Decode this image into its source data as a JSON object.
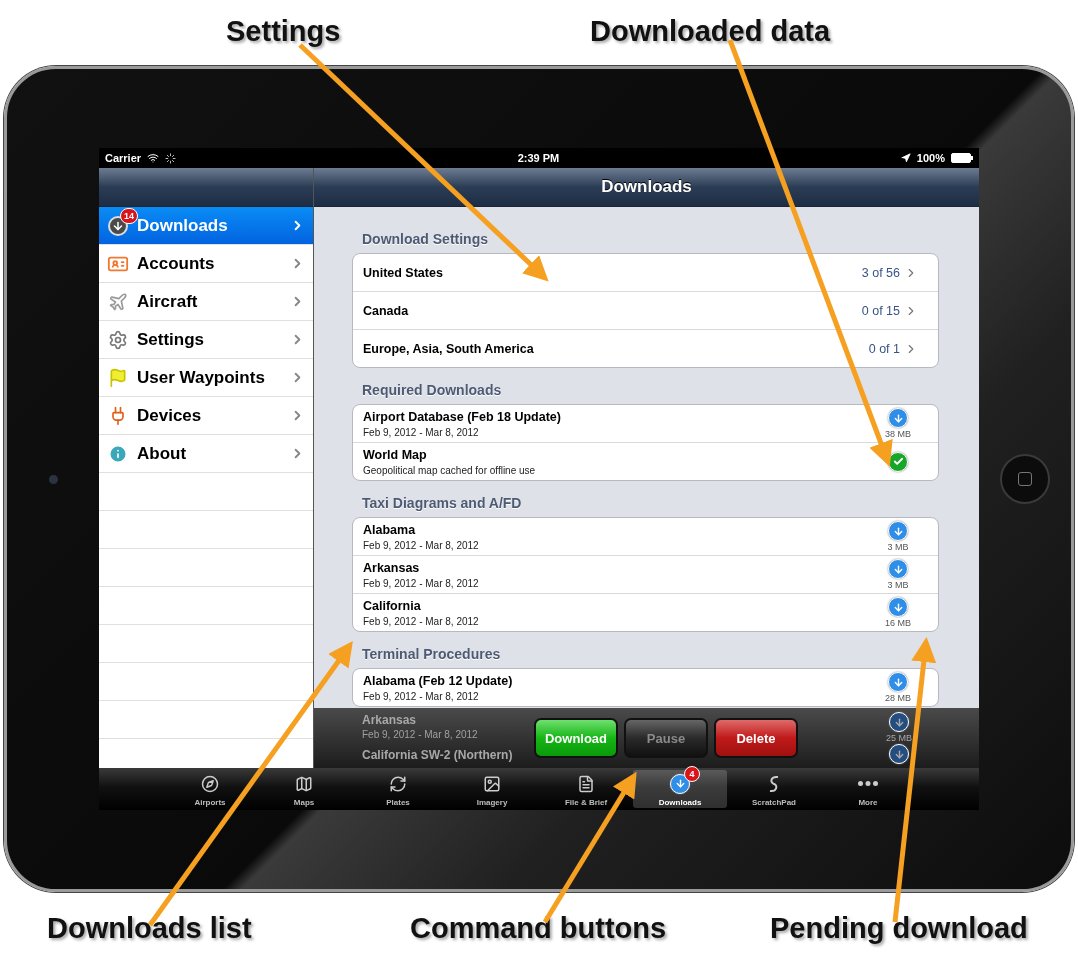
{
  "annotations_top": [
    {
      "label": "Settings"
    },
    {
      "label": "Downloaded data"
    }
  ],
  "status_bar": {
    "carrier": "Carrier",
    "time": "2:39 PM",
    "battery": "100%"
  },
  "sidebar": {
    "items": [
      {
        "label": "Downloads",
        "selected": true,
        "badge": "14"
      },
      {
        "label": "Accounts",
        "selected": false
      },
      {
        "label": "Aircraft",
        "selected": false
      },
      {
        "label": "Settings",
        "selected": false
      },
      {
        "label": "User Waypoints",
        "selected": false
      },
      {
        "label": "Devices",
        "selected": false
      },
      {
        "label": "About",
        "selected": false
      }
    ]
  },
  "header": {
    "title": "Downloads"
  },
  "sections": [
    {
      "title": "Download Settings",
      "rows": [
        {
          "kind": "setting",
          "title": "United States",
          "value": "3 of 56"
        },
        {
          "kind": "setting",
          "title": "Canada",
          "value": "0 of 15"
        },
        {
          "kind": "setting",
          "title": "Europe, Asia, South America",
          "value": "0 of 1"
        }
      ]
    },
    {
      "title": "Required Downloads",
      "rows": [
        {
          "kind": "download",
          "title": "Airport Database (Feb 18 Update)",
          "subtitle": "Feb 9, 2012 - Mar 8, 2012",
          "size": "38 MB"
        },
        {
          "kind": "downloaded",
          "title": "World Map",
          "subtitle": "Geopolitical map cached for offline use"
        }
      ]
    },
    {
      "title": "Taxi Diagrams and A/FD",
      "rows": [
        {
          "kind": "download",
          "title": "Alabama",
          "subtitle": "Feb 9, 2012 - Mar 8, 2012",
          "size": "3 MB"
        },
        {
          "kind": "download",
          "title": "Arkansas",
          "subtitle": "Feb 9, 2012 - Mar 8, 2012",
          "size": "3 MB"
        },
        {
          "kind": "download",
          "title": "California",
          "subtitle": "Feb 9, 2012 - Mar 8, 2012",
          "size": "16 MB"
        }
      ]
    },
    {
      "title": "Terminal Procedures",
      "rows": [
        {
          "kind": "download",
          "title": "Alabama (Feb 12 Update)",
          "subtitle": "Feb 9, 2012 - Mar 8, 2012",
          "size": "28 MB"
        }
      ]
    }
  ],
  "command_bar": {
    "rows_behind": [
      {
        "kind": "download",
        "title": "Arkansas",
        "subtitle": "Feb 9, 2012 - Mar 8, 2012",
        "size": "25 MB"
      },
      {
        "kind": "download",
        "title": "California SW-2 (Northern)"
      }
    ],
    "buttons": [
      {
        "label": "Download",
        "kind": "go",
        "disabled": false
      },
      {
        "label": "Pause",
        "kind": "neutral",
        "disabled": true
      },
      {
        "label": "Delete",
        "kind": "danger",
        "disabled": false
      }
    ]
  },
  "tab_bar": {
    "items": [
      {
        "label": "Airports",
        "selected": false
      },
      {
        "label": "Maps",
        "selected": false
      },
      {
        "label": "Plates",
        "selected": false
      },
      {
        "label": "Imagery",
        "selected": false
      },
      {
        "label": "File & Brief",
        "selected": false
      },
      {
        "label": "Downloads",
        "selected": true,
        "badge": "4"
      },
      {
        "label": "ScratchPad",
        "selected": false
      },
      {
        "label": "More",
        "selected": false
      }
    ]
  },
  "annotations_bottom": [
    {
      "label": "Downloads list"
    },
    {
      "label": "Command buttons"
    },
    {
      "label": "Pending download"
    }
  ]
}
